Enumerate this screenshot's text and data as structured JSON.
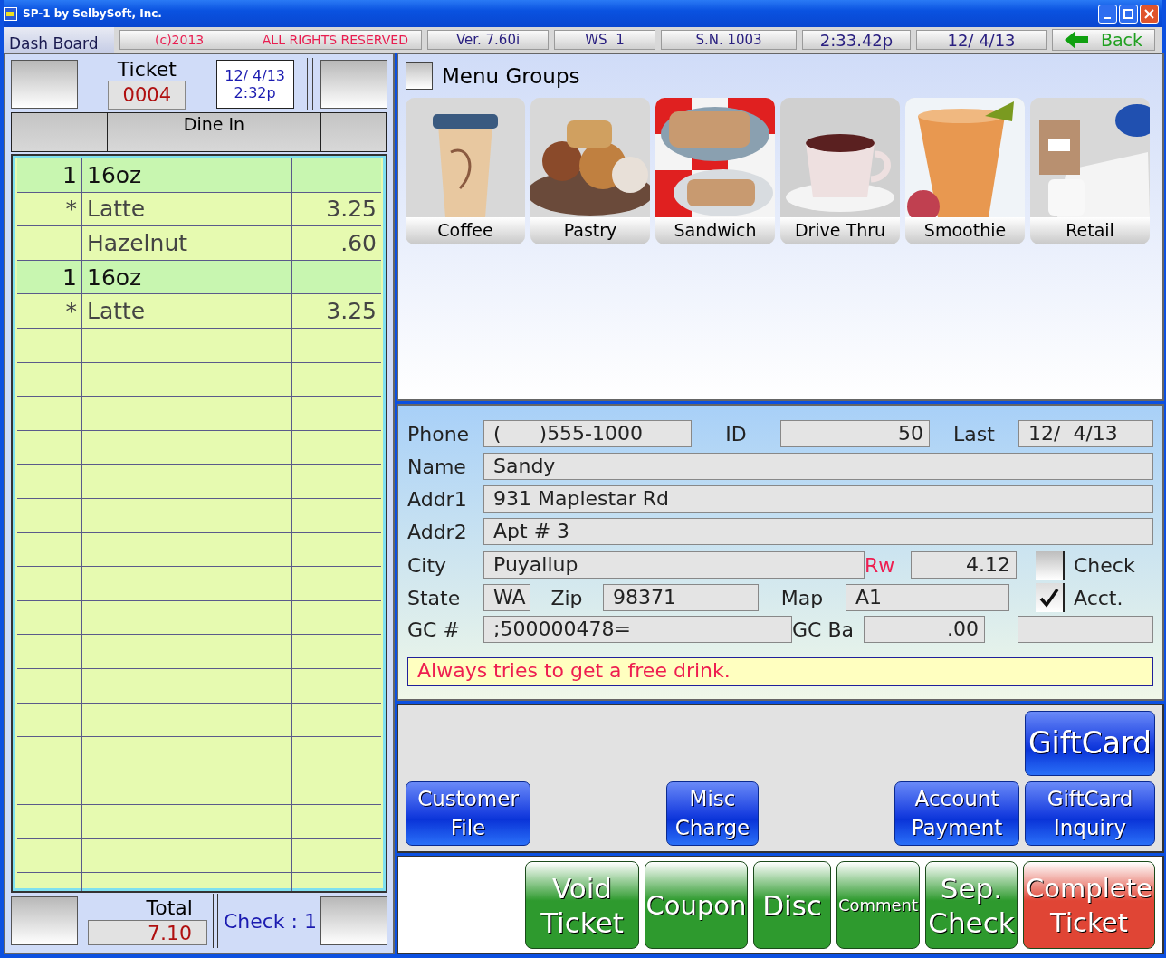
{
  "window": {
    "title": "SP-1 by SelbySoft, Inc."
  },
  "top_bar": {
    "tab": "Dash Board",
    "copyright": "(c)2013",
    "rights": "ALL RIGHTS RESERVED",
    "version": "Ver. 7.60i",
    "workstation": "WS  1",
    "serial": "S.N. 1003",
    "clock": "2:33.42p",
    "date": "12/ 4/13",
    "back": "Back"
  },
  "ticket": {
    "label": "Ticket",
    "number": "0004",
    "date": "12/ 4/13",
    "time": "2:32p",
    "order_type": "Dine In",
    "items": [
      {
        "qty": "1",
        "name": "16oz",
        "highlighted": true
      },
      {
        "mark": "*",
        "name": "Latte",
        "price": "3.25",
        "highlighted": false
      },
      {
        "name": "Hazelnut",
        "price": ".60",
        "highlighted": false
      },
      {
        "qty": "1",
        "name": "16oz",
        "highlighted": true
      },
      {
        "mark": "*",
        "name": "Latte",
        "price": "3.25",
        "highlighted": false
      }
    ],
    "total_label": "Total",
    "total": "7.10",
    "check": "Check : 1"
  },
  "menu_groups": {
    "title": "Menu Groups",
    "items": [
      {
        "label": "Coffee"
      },
      {
        "label": "Pastry"
      },
      {
        "label": "Sandwich"
      },
      {
        "label": "Drive Thru"
      },
      {
        "label": "Smoothie"
      },
      {
        "label": "Retail"
      }
    ]
  },
  "customer": {
    "lines": [
      {
        "parts": [
          {
            "kind": "label",
            "text": "Phone"
          },
          {
            "kind": "field",
            "value": "(      )555-1000"
          },
          {
            "kind": "label",
            "text": "ID"
          },
          {
            "kind": "field",
            "value": "50"
          },
          {
            "kind": "label",
            "text": "Last"
          },
          {
            "kind": "field",
            "value": "12/  4/13"
          }
        ]
      },
      {
        "parts": [
          {
            "kind": "label",
            "text": "Name"
          },
          {
            "kind": "field",
            "value": "Sandy"
          }
        ]
      },
      {
        "parts": [
          {
            "kind": "label",
            "text": "Addr1"
          },
          {
            "kind": "field",
            "value": "931 Maplestar Rd"
          }
        ]
      },
      {
        "parts": [
          {
            "kind": "label",
            "text": "Addr2"
          },
          {
            "kind": "field",
            "value": "Apt # 3"
          }
        ]
      },
      {
        "parts": [
          {
            "kind": "label",
            "text": "City"
          },
          {
            "kind": "field",
            "value": "Puyallup"
          },
          {
            "kind": "label",
            "text": "Rw",
            "color": "#ee1e50"
          },
          {
            "kind": "field",
            "value": "4.12"
          },
          {
            "kind": "checkbox",
            "checked": false
          },
          {
            "kind": "label",
            "text": "Check"
          }
        ]
      },
      {
        "parts": [
          {
            "kind": "label",
            "text": "State"
          },
          {
            "kind": "field",
            "value": "WA"
          },
          {
            "kind": "label",
            "text": "Zip"
          },
          {
            "kind": "field",
            "value": "98371"
          },
          {
            "kind": "label",
            "text": "Map"
          },
          {
            "kind": "field",
            "value": "A1"
          },
          {
            "kind": "checkbox",
            "checked": true
          },
          {
            "kind": "label",
            "text": "Acct."
          }
        ]
      },
      {
        "parts": [
          {
            "kind": "label",
            "text": "GC #"
          },
          {
            "kind": "field",
            "value": ";500000478="
          },
          {
            "kind": "label",
            "text": "GC Ba"
          },
          {
            "kind": "field",
            "value": ".00"
          },
          {
            "kind": "field"
          }
        ]
      }
    ],
    "note": "Always tries to get a free drink."
  },
  "function_buttons": [
    [
      {
        "label": "GiftCard"
      }
    ],
    [
      {
        "label": "Customer\nFile"
      },
      {
        "label": "Misc\nCharge"
      },
      {
        "label": "Account\nPayment"
      },
      {
        "label": "GiftCard\nInquiry"
      }
    ]
  ],
  "actions": [
    {
      "label": "Void\nTicket",
      "color": "#2e9a2e"
    },
    {
      "label": "Coupon",
      "color": "#2e9a2e"
    },
    {
      "label": "Disc",
      "color": "#2e9a2e"
    },
    {
      "label": "Comment",
      "color": "#2e9a2e"
    },
    {
      "label": "Sep.\nCheck",
      "color": "#2e9a2e"
    },
    {
      "label": "Complete\nTicket",
      "color": "#e04535"
    }
  ]
}
